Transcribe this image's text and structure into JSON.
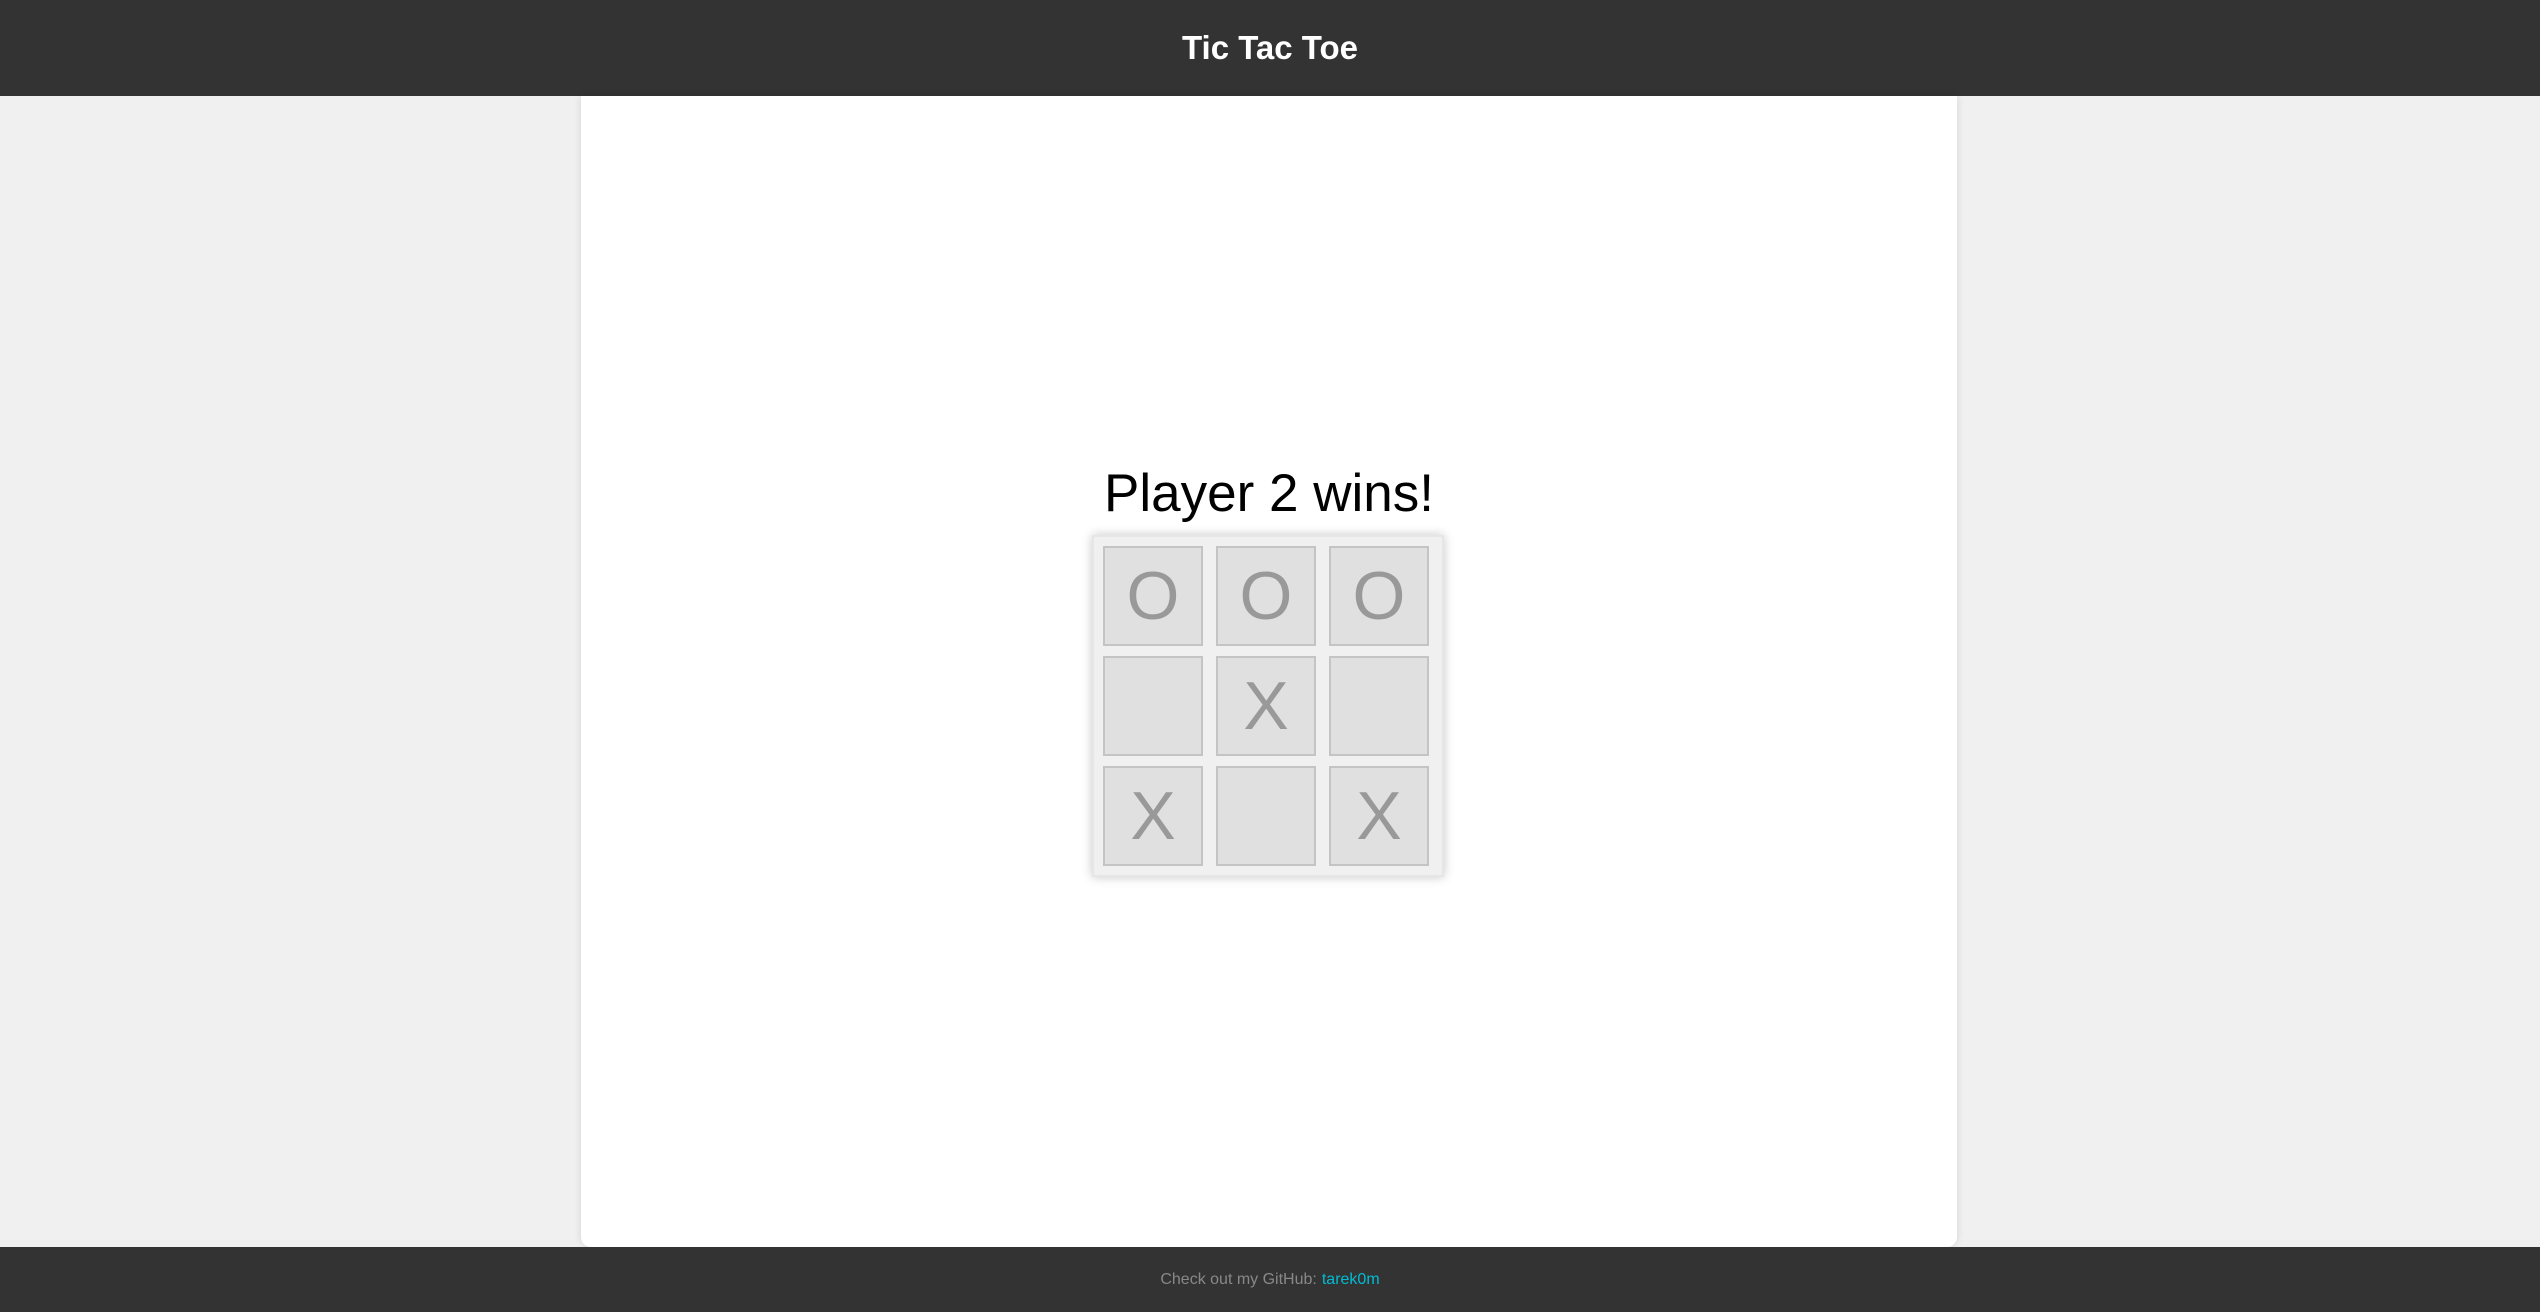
{
  "header": {
    "title": "Tic Tac Toe"
  },
  "game": {
    "status": "Player 2 wins!",
    "board": [
      [
        "O",
        "O",
        "O"
      ],
      [
        "",
        "X",
        ""
      ],
      [
        "X",
        "",
        "X"
      ]
    ]
  },
  "footer": {
    "text": "Check out my GitHub:",
    "link_label": "tarek0m"
  },
  "colors": {
    "header_bg": "#333333",
    "page_bg": "#f0f0f0",
    "card_bg": "#ffffff",
    "cell_bg": "#e0e0e0",
    "mark": "#999999",
    "link": "#00bcd4"
  }
}
